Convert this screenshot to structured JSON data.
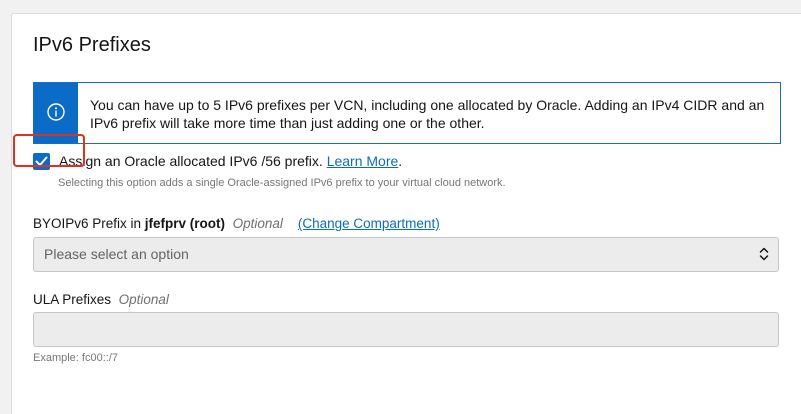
{
  "section": {
    "title": "IPv6 Prefixes"
  },
  "info": {
    "icon": "info-icon",
    "text": "You can have up to 5 IPv6 prefixes per VCN, including one allocated by Oracle. Adding an IPv4 CIDR and an IPv6 prefix will take more time than just adding one or the other."
  },
  "assign_checkbox": {
    "checked": true,
    "label": "Assign an Oracle allocated IPv6 /56 prefix.",
    "link": "Learn More",
    "after_link": ".",
    "hint": "Selecting this option adds a single Oracle-assigned IPv6 prefix to your virtual cloud network."
  },
  "byoip": {
    "label_prefix": "BYOIPv6 Prefix in ",
    "compartment": "jfefprv (root)",
    "optional": "Optional",
    "change_link": "(Change Compartment)",
    "select_placeholder": "Please select an option"
  },
  "ula": {
    "label": "ULA Prefixes",
    "optional": "Optional",
    "value": "",
    "example": "Example: fc00::/7"
  },
  "colors": {
    "accent": "#0a6cc7",
    "highlight": "#e0301e"
  }
}
